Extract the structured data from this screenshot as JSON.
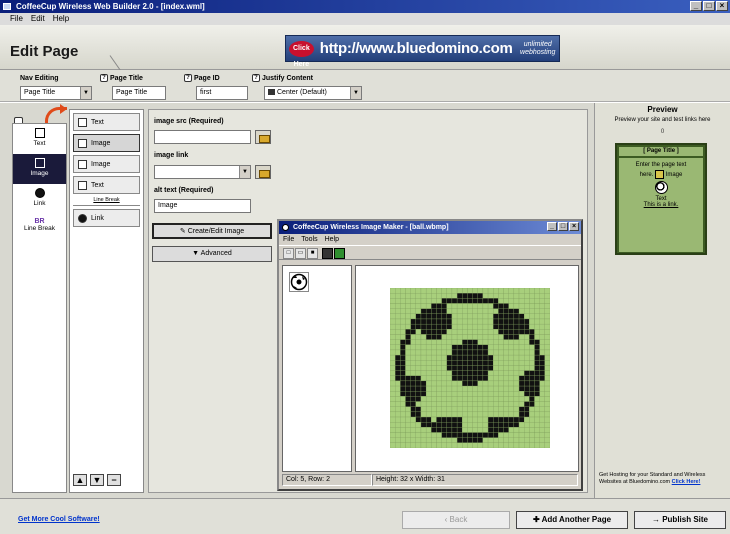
{
  "window": {
    "title": "CoffeeCup Wireless Web Builder 2.0 - [index.wml]",
    "controls": [
      "_",
      "□",
      "×"
    ]
  },
  "menu": [
    "File",
    "Edit",
    "Help"
  ],
  "header": {
    "page_title": "Edit Page",
    "banner": {
      "click_here": "Click Here",
      "url": "http://www.bluedomino.com",
      "tagline": "unlimited webhosting"
    }
  },
  "properties": {
    "nav_editing_label": "Nav Editing",
    "nav_editing_value": "Page Title",
    "page_title_label": "Page Title",
    "page_title_value": "Page Title",
    "page_id_label": "Page ID",
    "page_id_value": "first",
    "justify_label": "Justify Content",
    "justify_value": "Center (Default)"
  },
  "palette": {
    "items": [
      {
        "label": "Text",
        "icon": "text-icon"
      },
      {
        "label": "Image",
        "icon": "image-icon"
      },
      {
        "label": "Link",
        "icon": "link-icon"
      },
      {
        "label": "Line Break",
        "icon": "line-break-icon",
        "glyph": "BR"
      }
    ]
  },
  "elements": {
    "rows": [
      {
        "label": "Text"
      },
      {
        "label": "Image"
      },
      {
        "label": "Image"
      },
      {
        "label": "Text"
      },
      {
        "label": "Line Break"
      },
      {
        "label": "Link"
      }
    ],
    "controls": [
      "▲",
      "▼",
      "−"
    ]
  },
  "editor": {
    "image_src_label": "image src (Required)",
    "image_src_value": "",
    "image_link_label": "image link",
    "image_link_value": "",
    "alt_text_label": "alt text (Required)",
    "alt_text_value": "Image",
    "create_edit_label": "Create/Edit Image",
    "advanced_label": "Advanced"
  },
  "image_maker": {
    "title": "CoffeeCup Wireless Image Maker - [ball.wbmp]",
    "controls": [
      "_",
      "□",
      "×"
    ],
    "menu": [
      "File",
      "Tools",
      "Help"
    ],
    "status_position": "Col: 5, Row: 2",
    "status_size": "Height: 32 x Width: 31",
    "grid_size": 31,
    "colors": {
      "on": "#111111",
      "off": "#a8cf7c",
      "gridline": "#7f9e5a"
    }
  },
  "preview": {
    "title": "Preview",
    "subtitle": "Preview your site and test links here",
    "count": "0",
    "phone_header": "[ Page Title ]",
    "text_line1": "Enter the page text",
    "text_line2": "here.",
    "image_caption": "Image",
    "text_label": "Text",
    "link_text": "This is a link.",
    "hosting_text": "Get Hosting for your Standard and Wireless Websites at Bluedomino.com",
    "hosting_link": "Click Here!"
  },
  "footer": {
    "more_software": "Get More Cool Software!",
    "back_label": "‹ Back",
    "add_page_label": "✚ Add Another Page",
    "publish_label": "→ Publish Site"
  }
}
